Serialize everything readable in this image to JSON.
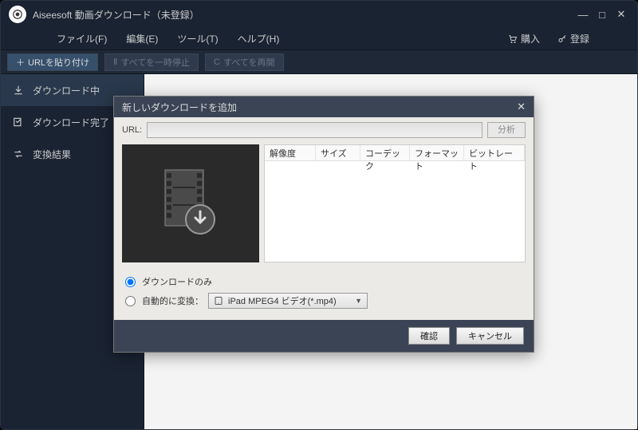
{
  "window": {
    "title": "Aiseesoft 動画ダウンロード（未登録）"
  },
  "menu": {
    "file": "ファイル(F)",
    "edit": "編集(E)",
    "tools": "ツール(T)",
    "help": "ヘルプ(H)",
    "buy": "購入",
    "register": "登録"
  },
  "toolbar": {
    "paste_url": "URLを貼り付け",
    "pause_all": "すべてを一時停止",
    "resume_all": "すべてを再開"
  },
  "sidebar": {
    "downloading": "ダウンロード中",
    "completed": "ダウンロード完了",
    "convert": "変換結果"
  },
  "dialog": {
    "title": "新しいダウンロードを追加",
    "url_label": "URL:",
    "url_value": "",
    "analyze": "分析",
    "columns": {
      "resolution": "解像度",
      "size": "サイズ",
      "codec": "コーデック",
      "format": "フォーマット",
      "bitrate": "ビットレート"
    },
    "opt_download_only": "ダウンロードのみ",
    "opt_auto_convert": "自動的に変換：",
    "format_selected": "iPad MPEG4 ビデオ(*.mp4)",
    "ok": "確認",
    "cancel": "キャンセル"
  }
}
